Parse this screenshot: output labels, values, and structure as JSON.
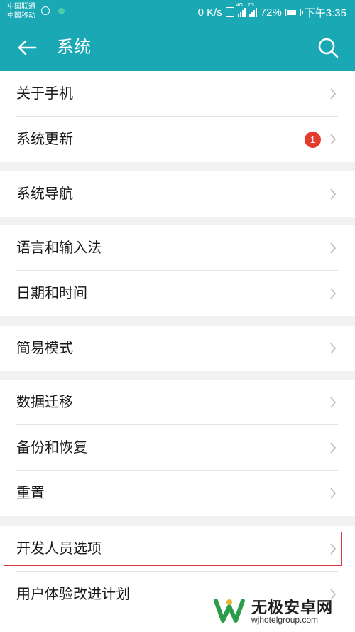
{
  "status_bar": {
    "carrier_1": "中国联通",
    "carrier_2": "中国移动",
    "speed": "0 K/s",
    "net_4g": "4G",
    "net_2g": "2G",
    "battery_percent": "72%",
    "battery_level": 0.72,
    "time": "下午3:35"
  },
  "app_bar": {
    "title": "系统",
    "back_icon": "arrow-left-icon",
    "search_icon": "search-icon"
  },
  "groups": [
    {
      "items": [
        {
          "label": "关于手机"
        },
        {
          "label": "系统更新",
          "badge": "1"
        }
      ]
    },
    {
      "items": [
        {
          "label": "系统导航"
        }
      ]
    },
    {
      "items": [
        {
          "label": "语言和输入法"
        },
        {
          "label": "日期和时间"
        }
      ]
    },
    {
      "items": [
        {
          "label": "简易模式"
        }
      ]
    },
    {
      "items": [
        {
          "label": "数据迁移"
        },
        {
          "label": "备份和恢复"
        },
        {
          "label": "重置"
        }
      ]
    },
    {
      "items": [
        {
          "label": "开发人员选项",
          "highlighted": true
        },
        {
          "label": "用户体验改进计划"
        }
      ]
    }
  ],
  "watermark": {
    "name": "无极安卓网",
    "url": "wjhotelgroup.com"
  },
  "colors": {
    "accent": "#1ba8b5",
    "badge": "#e33b2e",
    "highlight_border": "#d9363e",
    "background": "#f2f2f2"
  }
}
